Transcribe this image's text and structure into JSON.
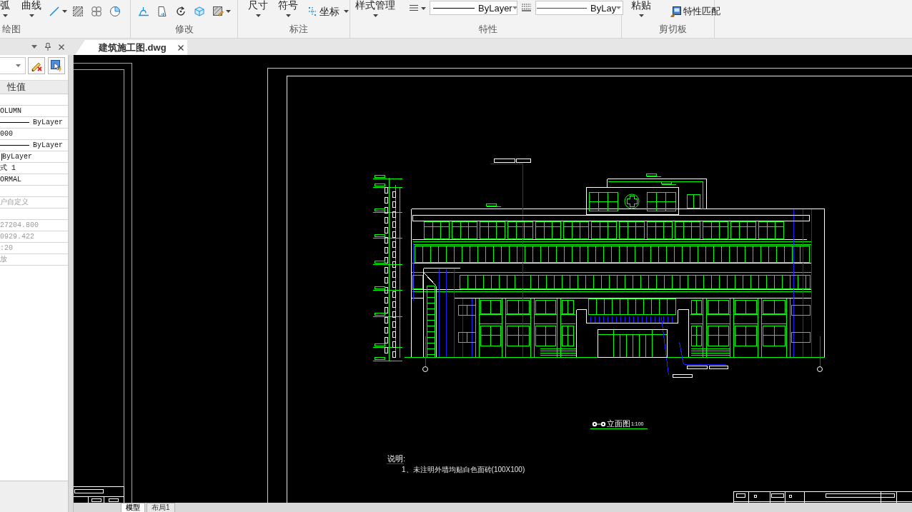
{
  "ribbon": {
    "draw_group": {
      "title": "绘图",
      "large_buttons": [
        "弧",
        "曲线"
      ]
    },
    "modify_group": {
      "title": "修改"
    },
    "annotate_group": {
      "title": "标注",
      "large_buttons": [
        "尺寸",
        "符号"
      ],
      "coordinate_button": "坐标"
    },
    "properties_group": {
      "title": "特性",
      "style_button": "样式管理",
      "dropdowns": [
        {
          "value": "ByLayer",
          "color": "#000000"
        },
        {
          "value": "ByLay",
          "color": "#e00000"
        }
      ]
    },
    "clipboard_group": {
      "title": "剪切板",
      "large_buttons": [
        "粘贴"
      ],
      "match_button": "特性匹配"
    }
  },
  "document_tabs": [
    {
      "label": "建筑施工图.dwg",
      "selected": true
    }
  ],
  "properties_panel": {
    "column_header": "性值",
    "rows": [
      {
        "kind": "blank"
      },
      {
        "kind": "text",
        "value": "OLUMN",
        "disabled": false
      },
      {
        "kind": "line",
        "value": "ByLayer",
        "disabled": false
      },
      {
        "kind": "text",
        "value": "000",
        "disabled": false
      },
      {
        "kind": "line",
        "value": "ByLayer",
        "disabled": false
      },
      {
        "kind": "swatch",
        "value": "ByLayer",
        "disabled": false
      },
      {
        "kind": "text",
        "value": "式 1",
        "disabled": false
      },
      {
        "kind": "text",
        "value": "ORMAL",
        "disabled": false
      },
      {
        "kind": "blank"
      },
      {
        "kind": "text",
        "value": "户自定义",
        "disabled": true
      },
      {
        "kind": "blank"
      },
      {
        "kind": "text",
        "value": "27204.800",
        "disabled": true
      },
      {
        "kind": "text",
        "value": "0929.422",
        "disabled": true
      },
      {
        "kind": "text",
        "value": ":20",
        "disabled": true
      },
      {
        "kind": "text",
        "value": "放",
        "disabled": true
      }
    ]
  },
  "drawing": {
    "caption": {
      "title": "立面图",
      "scale": "1:100"
    },
    "notes": {
      "heading": "说明:",
      "items": [
        "1、未注明外墙均贴白色面砖(100X100)"
      ]
    }
  },
  "layout_tabs": [
    {
      "label": "模型",
      "selected": true
    },
    {
      "label": "布局1",
      "selected": false
    }
  ]
}
